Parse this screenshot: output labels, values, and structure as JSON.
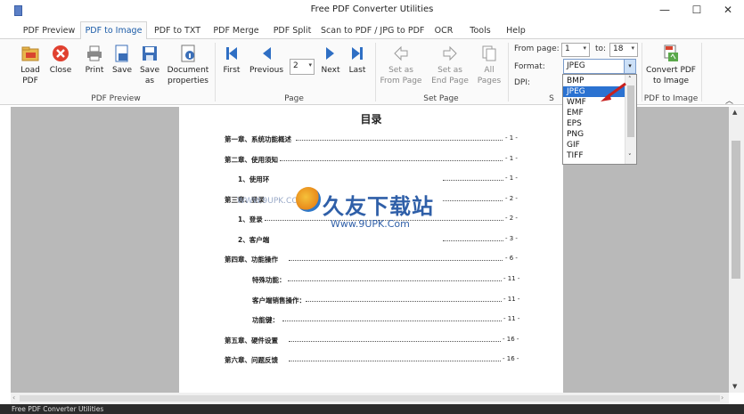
{
  "window": {
    "title": "Free PDF Converter Utilities",
    "minimize": "—",
    "maximize": "☐",
    "close": "✕"
  },
  "tabs": [
    {
      "label": "PDF Preview"
    },
    {
      "label": "PDF to Image"
    },
    {
      "label": "PDF to TXT"
    },
    {
      "label": "PDF Merge"
    },
    {
      "label": "PDF Split"
    },
    {
      "label": "Scan to PDF / JPG to PDF"
    },
    {
      "label": "OCR"
    },
    {
      "label": "Tools"
    },
    {
      "label": "Help"
    }
  ],
  "active_tab": "PDF to Image",
  "ribbon": {
    "preview_group": {
      "label": "PDF Preview",
      "load": "Load PDF",
      "close": "Close",
      "print": "Print",
      "save": "Save",
      "save_as": "Save as",
      "document_properties": "Document properties"
    },
    "page_group": {
      "label": "Page",
      "first": "First",
      "previous": "Previous",
      "page_value": "2",
      "next": "Next",
      "last": "Last"
    },
    "set_page_group": {
      "label": "Set Page",
      "from_page": "Set as From Page",
      "end_page": "Set as End Page",
      "all_pages": "All Pages"
    },
    "options": {
      "from_page_label": "From page:",
      "from_page_value": "1",
      "to_label": "to:",
      "to_value": "18",
      "format_label": "Format:",
      "format_value": "JPEG",
      "dpi_label": "DPI:",
      "group_label_partial": "S"
    },
    "convert_group": {
      "label": "PDF to Image",
      "convert": "Convert PDF to Image"
    },
    "collapse_icon": "chevron-up-icon"
  },
  "format_options": [
    "BMP",
    "JPEG",
    "WMF",
    "EMF",
    "EPS",
    "PNG",
    "GIF",
    "TIFF"
  ],
  "document": {
    "title": "目录",
    "entries": [
      {
        "label": "第一章、系统功能概述",
        "page": "- 1 -"
      },
      {
        "label": "第二章、使用须知",
        "page": "- 1 -"
      },
      {
        "label": "1、使用环",
        "page": "- 1 -"
      },
      {
        "label": "第三章、登录",
        "page": "- 2 -"
      },
      {
        "label": "1、登录",
        "page": "- 2 -"
      },
      {
        "label": "2、客户端",
        "page": "- 3 -"
      },
      {
        "label": "第四章、功能操作",
        "page": "- 6 -"
      },
      {
        "label": "特殊功能：",
        "page": "- 11 -"
      },
      {
        "label": "客户端销售操作：",
        "page": "- 11 -"
      },
      {
        "label": "功能键：",
        "page": "- 11 -"
      },
      {
        "label": "第五章、硬件设置",
        "page": "- 16 -"
      },
      {
        "label": "第六章、问题反馈",
        "page": "- 16 -"
      }
    ]
  },
  "watermark": {
    "main": "久友下载站",
    "url": "Www.9UPK.Com",
    "faint": "WWW.9UPK.COM"
  },
  "status": {
    "text": "Free PDF Converter Utilities"
  },
  "colors": {
    "accent": "#1c5ca8",
    "selection": "#2b72d1",
    "status_bg": "#2b2b2b"
  }
}
